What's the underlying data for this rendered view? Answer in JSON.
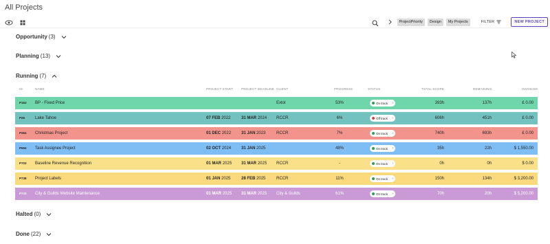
{
  "header": {
    "title": "All Projects"
  },
  "toolbar": {
    "view_icon": "eye-icon",
    "grid_icon": "grid-icon",
    "search_icon": "search-icon",
    "chips": [
      "ProjectPriority",
      "Design",
      "My Projects"
    ],
    "filter_label": "FILTER",
    "new_project_label": "NEW PROJECT"
  },
  "sections": {
    "opportunity": {
      "name": "Opportunity",
      "count": "(3)"
    },
    "planning": {
      "name": "Planning",
      "count": "(13)"
    },
    "running": {
      "name": "Running",
      "count": "(7)"
    },
    "halted": {
      "name": "Halted",
      "count": "(0)"
    },
    "done": {
      "name": "Done",
      "count": "(22)"
    }
  },
  "table": {
    "headers": {
      "id": "ID",
      "name": "NAME",
      "start": "PROJECT START",
      "deadline": "PROJECT DEADLINE",
      "client": "CLIENT",
      "progress": "PROGRESS",
      "status": "STATUS",
      "scope": "TOTAL SCOPE",
      "remaining": "REMAINING",
      "invoiced": "INVOICED"
    },
    "rows": [
      {
        "id": "P163",
        "name": "BP - Fixed Price",
        "start_b": "",
        "start_y": "",
        "deadline_b": "",
        "deadline_y": "",
        "client": "Extol",
        "progress": "53%",
        "status": "On track",
        "scope": "393h",
        "remaining": "137h",
        "invoiced": "£ 0.00",
        "color": "#6fd6ac",
        "status_color": "#2e9e55"
      },
      {
        "id": "P26",
        "name": "Lake Tahoe",
        "start_b": "07 FEB",
        "start_y": "2022",
        "deadline_b": "31 MAR",
        "deadline_y": "2024",
        "client": "RCCR",
        "progress": "6%",
        "status": "Off track",
        "scope": "606h",
        "remaining": "451h",
        "invoiced": "£ 0.00",
        "color": "#74c2c0",
        "status_color": "#d94040"
      },
      {
        "id": "P264",
        "name": "Christmas Project",
        "start_b": "01 DEC",
        "start_y": "2022",
        "deadline_b": "31 JAN",
        "deadline_y": "2023",
        "client": "RCCR",
        "progress": "7%",
        "status": "On track",
        "scope": "740h",
        "remaining": "693h",
        "invoiced": "£ 0.00",
        "color": "#f3948c",
        "status_color": "#2e9e55"
      },
      {
        "id": "P694",
        "name": "Task Assignee Project",
        "start_b": "02 OCT",
        "start_y": "2024",
        "deadline_b": "31 JAN",
        "deadline_y": "2025",
        "client": "",
        "progress": "48%",
        "status": "On track",
        "scope": "35h",
        "remaining": "22h",
        "invoiced": "$ 1,550.00",
        "color": "#7fbef5",
        "status_color": "#2e9e55"
      },
      {
        "id": "P703",
        "name": "Baseline Revenue Recognition",
        "start_b": "01 MAR",
        "start_y": "2025",
        "deadline_b": "31 MAR",
        "deadline_y": "2025",
        "client": "RCCR",
        "progress": "-",
        "status": "On track",
        "scope": "0h",
        "remaining": "0h",
        "invoiced": "$ 0.00",
        "color": "#fbe08a",
        "status_color": "#2e9e55"
      },
      {
        "id": "P738",
        "name": "Project Labels",
        "start_b": "01 JAN",
        "start_y": "2025",
        "deadline_b": "28 FEB",
        "deadline_y": "2025",
        "client": "RCCR",
        "progress": "11%",
        "status": "On track",
        "scope": "150h",
        "remaining": "134h",
        "invoiced": "$ 3,200.00",
        "color": "#fbd97d",
        "status_color": "#2e9e55"
      },
      {
        "id": "P743",
        "name": "City & Guilds Website Maintenance",
        "start_b": "01 MAR",
        "start_y": "2025",
        "deadline_b": "31 MAR",
        "deadline_y": "2025",
        "client": "City & Guilds",
        "progress": "61%",
        "status": "On track",
        "scope": "70h",
        "remaining": "20h",
        "invoiced": "$ 5,200.00",
        "color": "#c99ad6",
        "status_color": "#2e9e55"
      }
    ]
  }
}
